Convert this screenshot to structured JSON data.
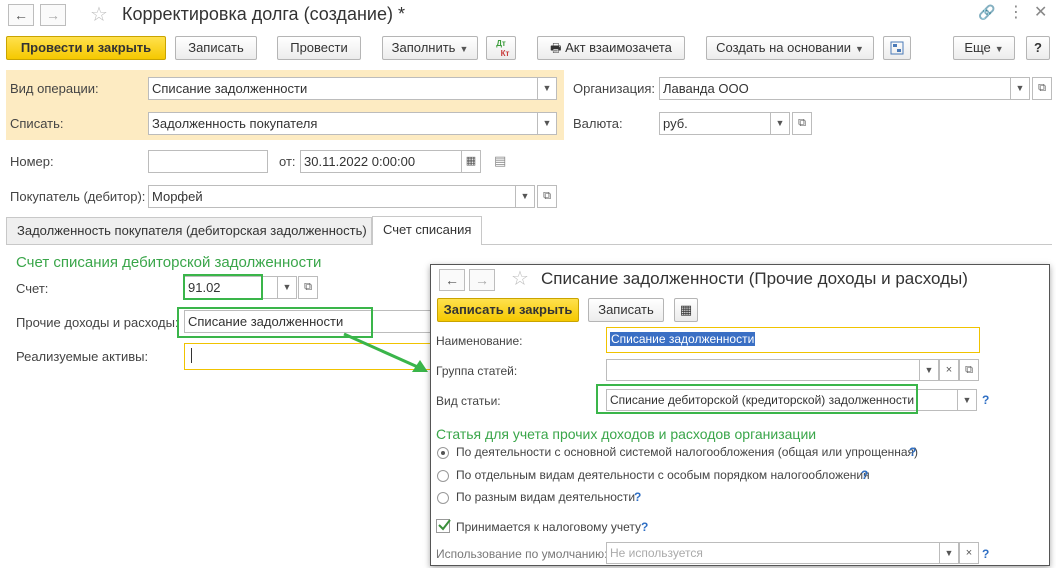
{
  "window": {
    "title": "Корректировка долга (создание) *",
    "nav_back": "←",
    "nav_forward": "→"
  },
  "toolbar": {
    "post_close": "Провести и закрыть",
    "save": "Записать",
    "post": "Провести",
    "fill": "Заполнить",
    "dtkt_top": "Дт",
    "dtkt_bottom": "Кт",
    "act": "Акт взаимозачета",
    "create_based": "Создать на основании",
    "more": "Еще",
    "help": "?"
  },
  "header": {
    "op_type_label": "Вид операции:",
    "op_type_value": "Списание задолженности",
    "write_off_label": "Списать:",
    "write_off_value": "Задолженность покупателя",
    "org_label": "Организация:",
    "org_value": "Лаванда ООО",
    "currency_label": "Валюта:",
    "currency_value": "руб.",
    "number_label": "Номер:",
    "number_value": "",
    "date_from_label": "от:",
    "date_value": "30.11.2022  0:00:00",
    "buyer_label": "Покупатель (дебитор):",
    "buyer_value": "Морфей"
  },
  "tabs": [
    {
      "label": "Задолженность покупателя (дебиторская задолженность)"
    },
    {
      "label": "Счет списания"
    }
  ],
  "account_section": {
    "title": "Счет списания дебиторской задолженности",
    "account_label": "Счет:",
    "account_value": "91.02",
    "other_income_label": "Прочие доходы и расходы:",
    "other_income_value": "Списание задолженности",
    "assets_label": "Реализуемые активы:",
    "assets_value": ""
  },
  "popup": {
    "title": "Списание задолженности (Прочие доходы и расходы)",
    "save_close": "Записать и закрыть",
    "save": "Записать",
    "name_label": "Наименование:",
    "name_value": "Списание задолженности",
    "group_label": "Группа статей:",
    "group_value": "",
    "kind_label": "Вид статьи:",
    "kind_value": "Списание дебиторской (кредиторской) задолженности",
    "section_title": "Статья для учета прочих доходов и расходов организации",
    "radio_options": [
      {
        "label": "По деятельности с основной системой налогообложения (общая или упрощенная)",
        "selected": true
      },
      {
        "label": "По отдельным видам деятельности с особым порядком налогообложения",
        "selected": false
      },
      {
        "label": "По разным видам деятельности",
        "selected": false
      }
    ],
    "tax_checkbox_label": "Принимается к налоговому учету",
    "tax_checkbox_checked": true,
    "default_usage_label": "Использование по умолчанию:",
    "default_usage_placeholder": "Не используется",
    "question": "?"
  },
  "colors": {
    "accent_yellow": "#f5c800",
    "highlight_bg": "#fdebc2",
    "annotation_green": "#3ab54a",
    "section_green": "#3aa64a"
  }
}
